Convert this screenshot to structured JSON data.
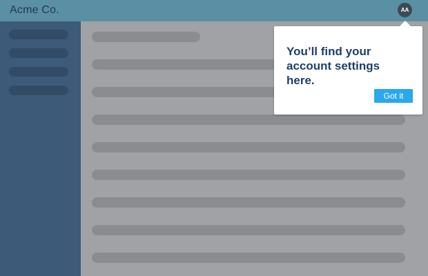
{
  "header": {
    "brand": "Acme Co.",
    "avatar_initials": "AA",
    "avatar_icon": "user-avatar-icon"
  },
  "sidebar": {
    "items": [
      {
        "type": "placeholder"
      },
      {
        "type": "placeholder"
      },
      {
        "type": "placeholder"
      },
      {
        "type": "placeholder"
      }
    ]
  },
  "main": {
    "rows": [
      {
        "type": "placeholder"
      },
      {
        "type": "placeholder"
      },
      {
        "type": "placeholder"
      },
      {
        "type": "placeholder"
      },
      {
        "type": "placeholder"
      },
      {
        "type": "placeholder"
      },
      {
        "type": "placeholder"
      },
      {
        "type": "placeholder"
      },
      {
        "type": "placeholder"
      }
    ]
  },
  "popover": {
    "message": "You’ll find your account settings here.",
    "button_label": "Got it"
  },
  "colors": {
    "header_bg": "#5b8fa4",
    "sidebar_bg": "#3d5a78",
    "content_bg": "#a0a2a5",
    "skeleton": "#8b8c8f",
    "accent": "#29a8ec",
    "popover_text": "#1e3f6a"
  }
}
